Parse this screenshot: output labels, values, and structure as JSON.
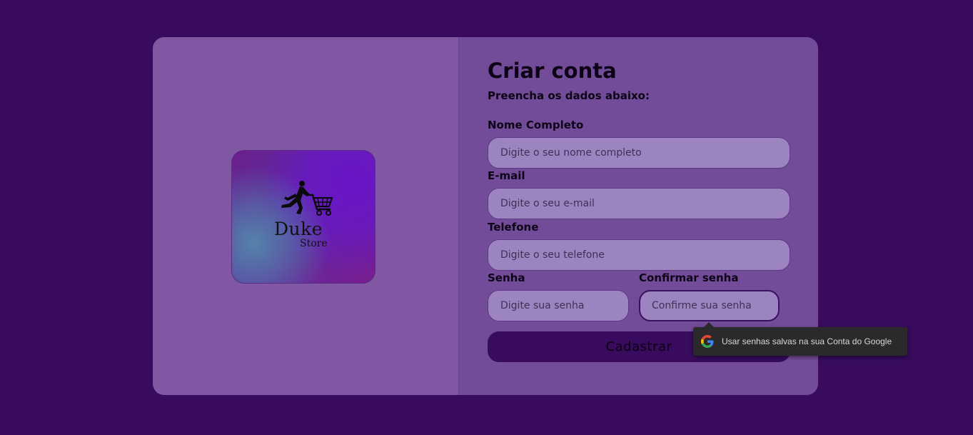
{
  "brand": {
    "name": "Duke",
    "sub": "Store"
  },
  "form": {
    "title": "Criar conta",
    "subtitle": "Preencha os dados abaixo:",
    "fields": {
      "name": {
        "label": "Nome Completo",
        "placeholder": "Digite o seu nome completo",
        "value": ""
      },
      "email": {
        "label": "E-mail",
        "placeholder": "Digite o seu e-mail",
        "value": ""
      },
      "phone": {
        "label": "Telefone",
        "placeholder": "Digite o seu telefone",
        "value": ""
      },
      "password": {
        "label": "Senha",
        "placeholder": "Digite sua senha",
        "value": ""
      },
      "confirm": {
        "label": "Confirmar senha",
        "placeholder": "Confirme sua senha",
        "value": ""
      }
    },
    "submit_label": "Cadastrar"
  },
  "autofill_popup": {
    "icon": "google-icon",
    "text": "Usar senhas salvas na sua Conta do Google"
  },
  "colors": {
    "background": "#380b5e",
    "left_panel": "#7f57a3",
    "right_panel": "#734c99",
    "input_bg": "#9b84bf",
    "button_bg": "#380b5e"
  }
}
